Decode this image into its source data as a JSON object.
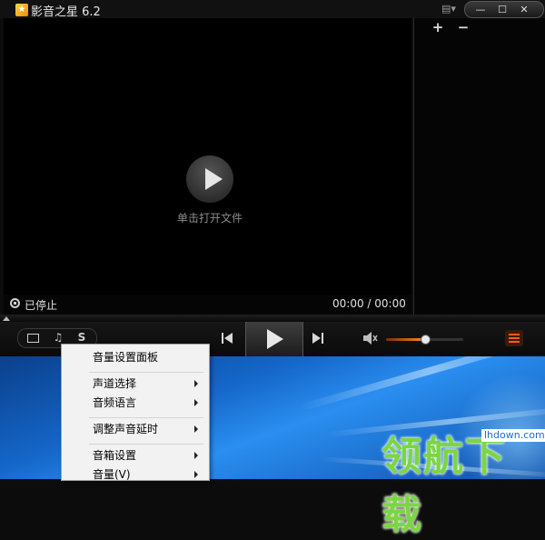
{
  "window": {
    "title": "影音之星 6.2",
    "menu_glyph": "▤▾",
    "minimize_glyph": "—",
    "maximize_glyph": "☐",
    "close_glyph": "✕"
  },
  "playlist": {
    "add_glyph": "+",
    "remove_glyph": "−"
  },
  "video": {
    "open_hint": "单击打开文件"
  },
  "status": {
    "state": "已停止",
    "time": "00:00 / 00:00"
  },
  "controls": {
    "audio_mode_glyph": "♫",
    "s_mode_label": "S",
    "volume_level": 0.5
  },
  "context_menu": {
    "items": [
      {
        "label": "音量设置面板",
        "enabled": true,
        "submenu": false
      },
      {
        "label": "声道选择",
        "enabled": false,
        "submenu": true
      },
      {
        "label": "音频语言",
        "enabled": false,
        "submenu": true
      },
      {
        "label": "调整声音延时",
        "enabled": false,
        "submenu": true
      },
      {
        "label": "音箱设置",
        "enabled": true,
        "submenu": true
      },
      {
        "label": "音量(V)",
        "enabled": true,
        "submenu": true
      }
    ]
  },
  "watermark": {
    "url": "lhdown.com",
    "text": "领航下载"
  },
  "colors": {
    "accent_orange": "#ff8a2a",
    "background": "#000000"
  },
  "icons": [
    "app-star-icon",
    "menu-icon",
    "minimize-icon",
    "maximize-icon",
    "close-icon",
    "add-icon",
    "remove-icon",
    "play-icon",
    "stop-icon",
    "screen-icon",
    "music-note-icon",
    "previous-icon",
    "next-icon",
    "volume-icon",
    "playlist-icon",
    "submenu-arrow-icon"
  ]
}
